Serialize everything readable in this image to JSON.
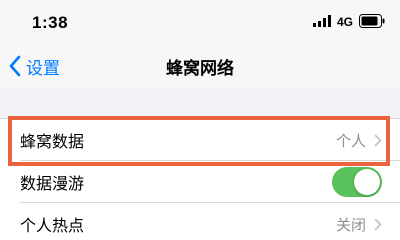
{
  "status_bar": {
    "time": "1:38",
    "network": "4G"
  },
  "nav": {
    "back_label": "设置",
    "title": "蜂窝网络"
  },
  "rows": [
    {
      "label": "蜂窝数据",
      "detail": "个人"
    },
    {
      "label": "数据漫游",
      "toggle_on": true
    },
    {
      "label": "个人热点",
      "detail": "关闭"
    }
  ],
  "colors": {
    "accent": "#007aff",
    "toggle_on": "#5ac25b",
    "highlight": "#e9643f"
  },
  "icons": [
    "signal-icon",
    "battery-icon",
    "back-chevron-icon",
    "chevron-right-icon"
  ]
}
